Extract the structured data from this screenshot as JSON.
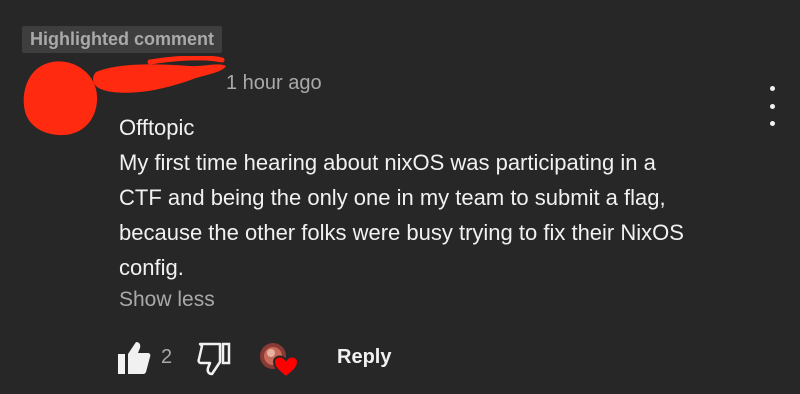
{
  "badge": {
    "label": "Highlighted comment"
  },
  "comment": {
    "timestamp": "1 hour ago",
    "lines": [
      "Offtopic",
      "My first time hearing about nixOS was participating in a",
      "CTF and being the only one in my team to submit a flag,",
      "because the other folks were busy trying to fix their NixOS",
      "config."
    ],
    "show_less_label": "Show less"
  },
  "actions": {
    "like_count": "2",
    "reply_label": "Reply",
    "like_icon": "thumbs-up-icon",
    "dislike_icon": "thumbs-down-icon",
    "hearted_icon": "creator-heart-icon"
  },
  "colors": {
    "background": "#272727",
    "badge_bg": "#3e3e3e",
    "primary_text": "#f1f1f1",
    "secondary_text": "#a9a9a9",
    "redaction": "#ff2a0f",
    "heart": "#ff0000"
  }
}
